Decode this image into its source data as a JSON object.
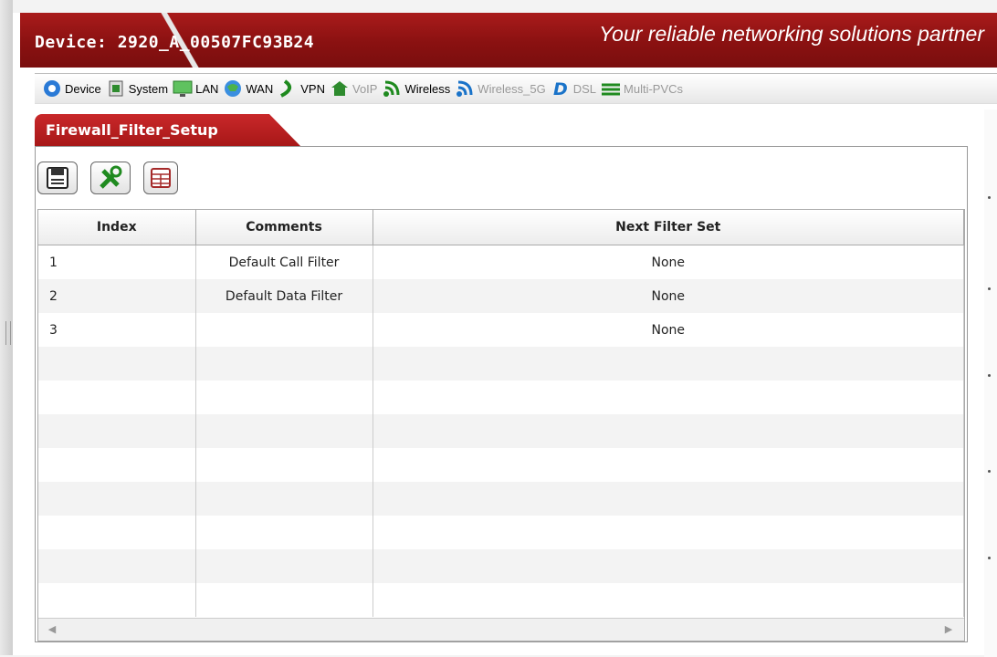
{
  "header": {
    "device_title": "Device: 2920_A_00507FC93B24",
    "tagline": "Your reliable networking solutions partner"
  },
  "menu": {
    "items": [
      {
        "label": "Device",
        "icon": "device-icon",
        "enabled": true
      },
      {
        "label": "System",
        "icon": "system-icon",
        "enabled": true
      },
      {
        "label": "LAN",
        "icon": "lan-icon",
        "enabled": true
      },
      {
        "label": "WAN",
        "icon": "wan-icon",
        "enabled": true
      },
      {
        "label": "VPN",
        "icon": "vpn-icon",
        "enabled": true
      },
      {
        "label": "VoIP",
        "icon": "voip-icon",
        "enabled": false
      },
      {
        "label": "Wireless",
        "icon": "wireless-icon",
        "enabled": true
      },
      {
        "label": "Wireless_5G",
        "icon": "wireless-5g-icon",
        "enabled": false
      },
      {
        "label": "DSL",
        "icon": "dsl-icon",
        "enabled": false
      },
      {
        "label": "Multi-PVCs",
        "icon": "multi-pvcs-icon",
        "enabled": false
      }
    ]
  },
  "page": {
    "tab_title": "Firewall_Filter_Setup"
  },
  "toolbar": {
    "buttons": [
      "save-icon",
      "tools-icon",
      "table-icon"
    ]
  },
  "table": {
    "columns": [
      "Index",
      "Comments",
      "Next Filter Set"
    ],
    "rows": [
      {
        "index": "1",
        "comments": "Default Call Filter",
        "next": "None"
      },
      {
        "index": "2",
        "comments": "Default Data Filter",
        "next": "None"
      },
      {
        "index": "3",
        "comments": "",
        "next": "None"
      }
    ]
  },
  "colors": {
    "brand_red": "#a91b1b",
    "tab_red": "#c9282a",
    "icon_green": "#1f8a1f",
    "icon_blue": "#1a73c9"
  }
}
